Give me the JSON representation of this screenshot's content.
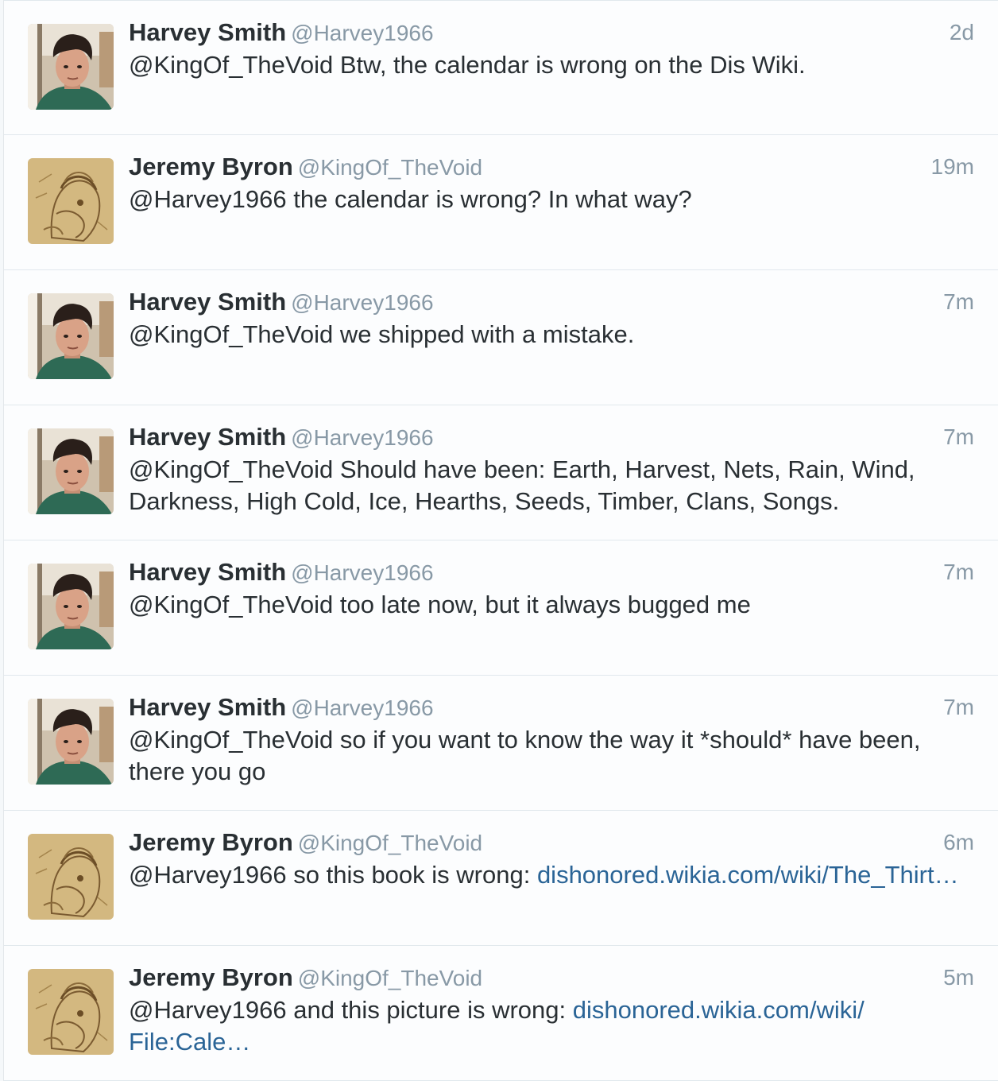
{
  "tweets": [
    {
      "avatar": "harvey-avatar",
      "name": "Harvey Smith",
      "handle": "@Harvey1966",
      "time": "2d",
      "text": "@KingOf_TheVoid Btw, the calendar is wrong on the Dis Wiki.",
      "link": ""
    },
    {
      "avatar": "jeremy-avatar",
      "name": "Jeremy Byron",
      "handle": "@KingOf_TheVoid",
      "time": "19m",
      "text": "@Harvey1966 the calendar is wrong? In what way?",
      "link": ""
    },
    {
      "avatar": "harvey-avatar",
      "name": "Harvey Smith",
      "handle": "@Harvey1966",
      "time": "7m",
      "text": "@KingOf_TheVoid we shipped with a mistake.",
      "link": ""
    },
    {
      "avatar": "harvey-avatar",
      "name": "Harvey Smith",
      "handle": "@Harvey1966",
      "time": "7m",
      "text": "@KingOf_TheVoid Should have been: Earth, Harvest, Nets, Rain, Wind, Darkness, High Cold, Ice, Hearths, Seeds, Timber, Clans, Songs.",
      "link": ""
    },
    {
      "avatar": "harvey-avatar",
      "name": "Harvey Smith",
      "handle": "@Harvey1966",
      "time": "7m",
      "text": "@KingOf_TheVoid too late now, but it always bugged me",
      "link": ""
    },
    {
      "avatar": "harvey-avatar",
      "name": "Harvey Smith",
      "handle": "@Harvey1966",
      "time": "7m",
      "text": "@KingOf_TheVoid so if you want to know the way it *should* have been, there you go",
      "link": ""
    },
    {
      "avatar": "jeremy-avatar",
      "name": "Jeremy Byron",
      "handle": "@KingOf_TheVoid",
      "time": "6m",
      "text": "@Harvey1966 so this book is wrong: ",
      "link": "dishonored.wikia.com/wiki/​The_Thirt…"
    },
    {
      "avatar": "jeremy-avatar",
      "name": "Jeremy Byron",
      "handle": "@KingOf_TheVoid",
      "time": "5m",
      "text": "@Harvey1966 and this picture is wrong: ",
      "link": "dishonored.wikia.com/wiki/​File:Cale…"
    }
  ],
  "colors": {
    "name": "#292f33",
    "meta": "#8899a6",
    "link": "#2a6496",
    "divider": "#e1e8ed"
  }
}
